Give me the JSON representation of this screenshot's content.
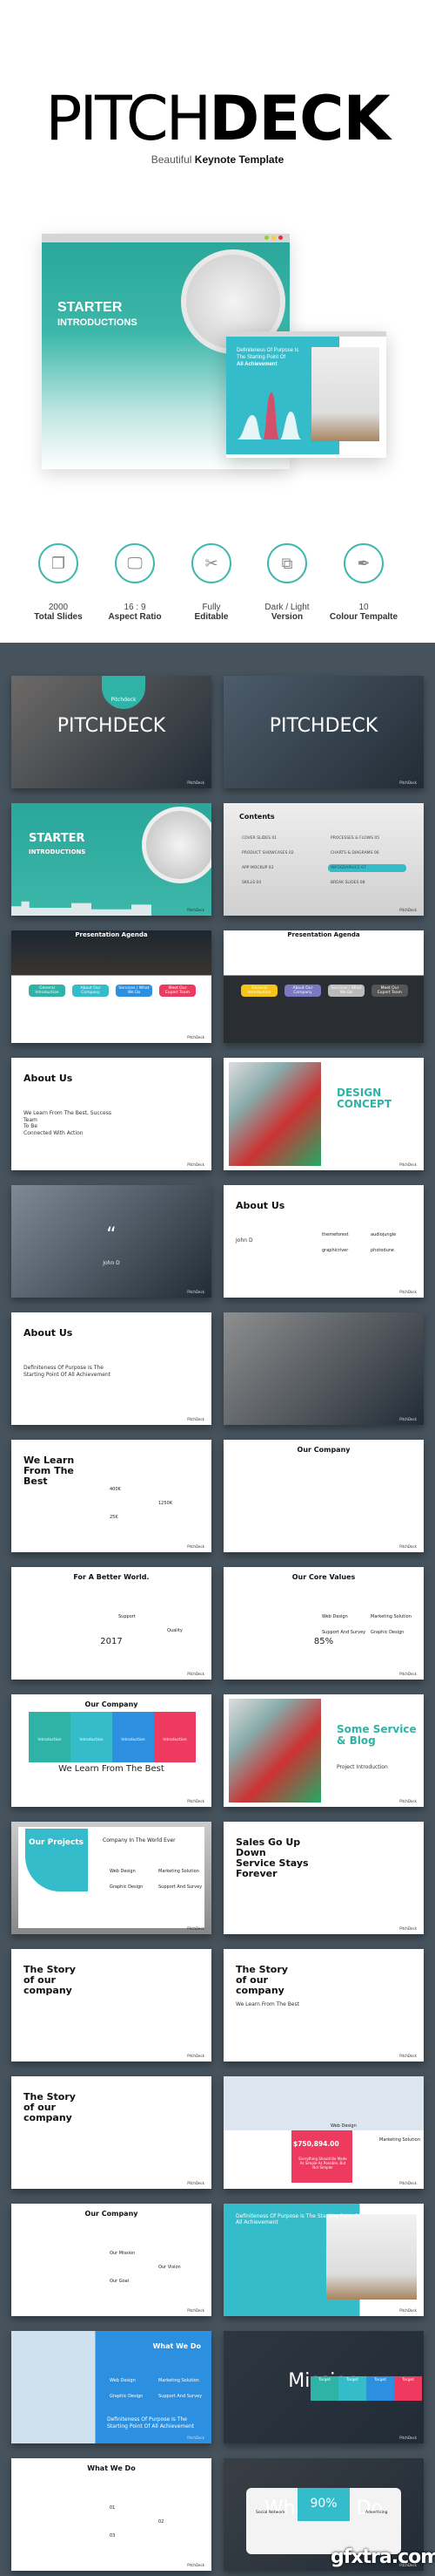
{
  "hero": {
    "title_thin": "PITCH",
    "title_bold": "DECK",
    "subtitle_light": "Beautiful",
    "subtitle_bold": "Keynote Template",
    "mockup": {
      "title": "STARTER",
      "subtitle": "INTRODUCTIONS",
      "chart_text": "Definiteness Of Purpose Is The Starting Point Of",
      "chart_text_bold": "All Achievement"
    }
  },
  "features": [
    {
      "icon": "stacked-slides-icon",
      "line1": "2000",
      "line2": "Total Slides"
    },
    {
      "icon": "monitor-icon",
      "line1": "16 : 9",
      "line2": "Aspect Ratio"
    },
    {
      "icon": "tools-icon",
      "line1": "Fully",
      "line2": "Editable"
    },
    {
      "icon": "dual-monitor-icon",
      "line1": "Dark / Light",
      "line2": "Version"
    },
    {
      "icon": "pen-nib-icon",
      "line1": "10",
      "line2": "Colour Tempalte"
    }
  ],
  "colors": {
    "teal": "#2fb3a6",
    "cyan": "#35bccb",
    "blue": "#2d8fe0",
    "red": "#ee3a5e",
    "yellow": "#f5c518",
    "dark_bg": "#46525c"
  },
  "slides": [
    {
      "kind": "photo",
      "bg": "#6d6a68",
      "title": "PITCHDECK",
      "badge": "Pitchdeck"
    },
    {
      "kind": "photo",
      "bg": "#4c5c6a",
      "title": "PITCHDECK"
    },
    {
      "kind": "teal",
      "title": "STARTER",
      "sub": "INTRODUCTIONS"
    },
    {
      "kind": "contents",
      "title": "Contents",
      "items": [
        "COVER SLIDES 01",
        "PRODUCT SHOWCASES 02",
        "APP MOCKUP 03",
        "SKILLS 04",
        "PROCESSES & FLOWS 05",
        "CHARTS & DIAGRAMS 06",
        "INFOGRAPHICS 07",
        "BREAK SLIDES 08"
      ]
    },
    {
      "kind": "agenda-dark",
      "title": "Presentation Agenda",
      "items": [
        "General Introduction",
        "About Our Company",
        "Services / What We Do",
        "Meet Our Expert Team"
      ]
    },
    {
      "kind": "agenda-light",
      "title": "Presentation Agenda",
      "items": [
        "General Introduction",
        "About Our Company",
        "Services / What We Do",
        "Meet Our Expert Team"
      ]
    },
    {
      "kind": "white",
      "title": "About Us",
      "sub": "We Learn From The Best, Success Team\nTo Be\nConnected With Action"
    },
    {
      "kind": "white-right",
      "title": "DESIGN\nCONCEPT"
    },
    {
      "kind": "photo",
      "bg": "#7d8a96",
      "title": "“",
      "sub": "John D"
    },
    {
      "kind": "white",
      "title": "About Us",
      "sub": "John D",
      "items": [
        "themeforest",
        "audiojungle",
        "graphicriver",
        "photodune"
      ]
    },
    {
      "kind": "white",
      "title": "About Us",
      "sub": "Definiteness Of Purpose Is The Starting Point Of All Achievement"
    },
    {
      "kind": "photo",
      "bg": "#8e8e8e",
      "title": ""
    },
    {
      "kind": "white",
      "title": "We Learn\nFrom The\nBest",
      "items": [
        "400K",
        "1250K",
        "25K"
      ]
    },
    {
      "kind": "white-center",
      "title": "Our Company"
    },
    {
      "kind": "white-center",
      "title": "For A Better World.",
      "sub": "2017",
      "items": [
        "Support",
        "Quality"
      ]
    },
    {
      "kind": "white-center",
      "title": "Our Core Values",
      "sub": "85%",
      "items": [
        "Web Design",
        "Marketing Solution",
        "Support And Survey",
        "Graphic Design"
      ]
    },
    {
      "kind": "white-center",
      "title": "Our Company",
      "sub": "We Learn From The Best",
      "items": [
        "Introduction",
        "Introduction",
        "Introduction",
        "Introduction"
      ]
    },
    {
      "kind": "white-right",
      "title": "Some Service\n& Blog",
      "sub": "Project Introduction"
    },
    {
      "kind": "teal-card",
      "title": "Our Projects",
      "sub": "Company In The World Ever",
      "items": [
        "Web Design",
        "Marketing Solution",
        "Graphic Design",
        "Support And Survey"
      ]
    },
    {
      "kind": "white",
      "title": "Sales Go Up\nDown\nService Stays\nForever"
    },
    {
      "kind": "white",
      "title": "The Story\nof our\ncompany"
    },
    {
      "kind": "white",
      "title": "The Story\nof our\ncompany",
      "sub": "We Learn From The Best"
    },
    {
      "kind": "white",
      "title": "The Story\nof our\ncompany"
    },
    {
      "kind": "red-stat",
      "title": "$750,894.00",
      "sub": "Everything Should Be Made As Simple As Possible, But Not Simpler",
      "items": [
        "Web Design",
        "Marketing Solution"
      ]
    },
    {
      "kind": "white-center",
      "title": "Our Company",
      "items": [
        "Our Mission",
        "Our Vision",
        "Our Goal"
      ]
    },
    {
      "kind": "cyan",
      "title": "Definiteness Of Purpose Is The Starting Point Of\nAll Achievement"
    },
    {
      "kind": "blue",
      "title": "What We Do",
      "sub": "Definiteness Of Purpose Is The Starting Point Of All Achievement",
      "items": [
        "Web Design",
        "Marketing Solution",
        "Graphic Design",
        "Support And Survey"
      ]
    },
    {
      "kind": "photo",
      "bg": "#2e3640",
      "title": "Mission",
      "items": [
        "Target",
        "Target",
        "Target",
        "Target"
      ]
    },
    {
      "kind": "white-center",
      "title": "What We Do",
      "items": [
        "01",
        "02",
        "03"
      ]
    },
    {
      "kind": "photo",
      "bg": "#3a3f45",
      "title": "What We Do",
      "sub": "90%",
      "items": [
        "Social Network",
        "Advertising"
      ]
    }
  ],
  "footer_brand": "PitchDeck",
  "watermark": "gfxtra.com"
}
